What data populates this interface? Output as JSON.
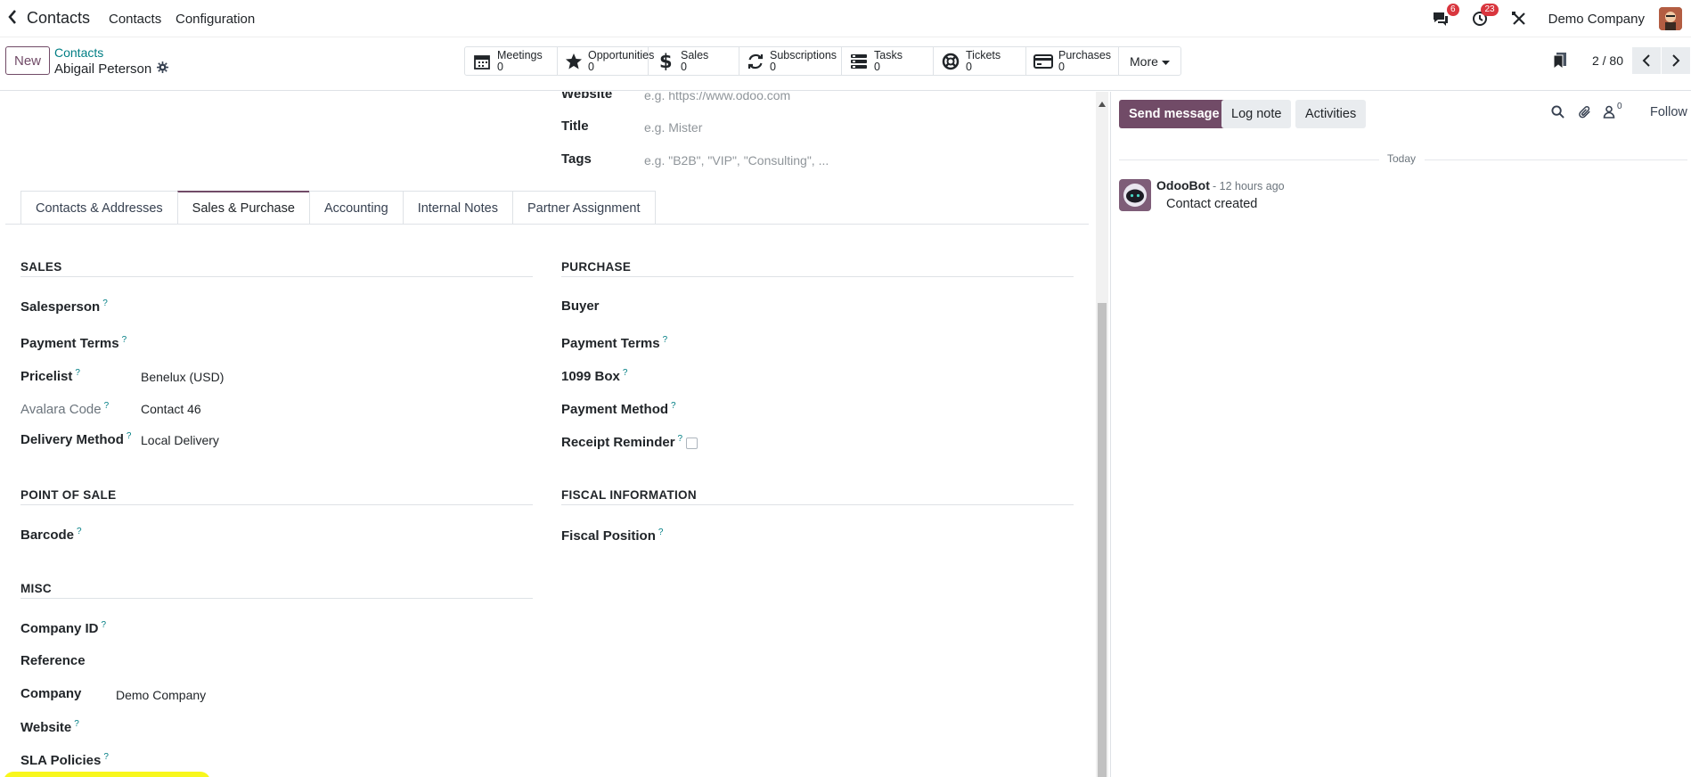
{
  "navbar": {
    "app_name": "Contacts",
    "menu": [
      "Contacts",
      "Configuration"
    ],
    "messages_badge": "6",
    "activities_badge": "23",
    "company": "Demo Company"
  },
  "control": {
    "new_label": "New",
    "breadcrumb_parent": "Contacts",
    "record_name": "Abigail Peterson",
    "smart_buttons": [
      {
        "label": "Meetings",
        "count": "0",
        "icon": "calendar-icon"
      },
      {
        "label": "Opportunities",
        "count": "0",
        "icon": "star-icon"
      },
      {
        "label": "Sales",
        "count": "0",
        "icon": "dollar-icon"
      },
      {
        "label": "Subscriptions",
        "count": "0",
        "icon": "refresh-icon"
      },
      {
        "label": "Tasks",
        "count": "0",
        "icon": "tasks-icon"
      },
      {
        "label": "Tickets",
        "count": "0",
        "icon": "lifebuoy-icon"
      },
      {
        "label": "Purchases",
        "count": "0",
        "icon": "credit-card-icon"
      }
    ],
    "more_label": "More",
    "pager": "2 / 80"
  },
  "form": {
    "top_fields": {
      "website_label": "Website",
      "website_placeholder": "e.g. https://www.odoo.com",
      "title_label": "Title",
      "title_placeholder": "e.g. Mister",
      "tags_label": "Tags",
      "tags_placeholder": "e.g. \"B2B\", \"VIP\", \"Consulting\", ..."
    },
    "tabs": [
      "Contacts & Addresses",
      "Sales & Purchase",
      "Accounting",
      "Internal Notes",
      "Partner Assignment"
    ],
    "active_tab": "Sales & Purchase",
    "sales": {
      "title": "SALES",
      "salesperson": "Salesperson",
      "payment_terms": "Payment Terms",
      "pricelist": "Pricelist",
      "pricelist_value": "Benelux (USD)",
      "avalara_code": "Avalara Code",
      "avalara_value": "Contact 46",
      "delivery_method": "Delivery Method",
      "delivery_value": "Local Delivery"
    },
    "purchase": {
      "title": "PURCHASE",
      "buyer": "Buyer",
      "payment_terms": "Payment Terms",
      "box_1099": "1099 Box",
      "payment_method": "Payment Method",
      "receipt_reminder": "Receipt Reminder"
    },
    "pos": {
      "title": "POINT OF SALE",
      "barcode": "Barcode"
    },
    "fiscal": {
      "title": "FISCAL INFORMATION",
      "fiscal_position": "Fiscal Position"
    },
    "misc": {
      "title": "MISC",
      "company_id": "Company ID",
      "reference": "Reference",
      "company": "Company",
      "company_value": "Demo Company",
      "website": "Website",
      "sla_policies": "SLA Policies"
    },
    "help_mark": "?"
  },
  "chatter": {
    "send_message": "Send message",
    "log_note": "Log note",
    "activities": "Activities",
    "followers_count": "0",
    "follow": "Follow",
    "today": "Today",
    "message": {
      "author": "OdooBot",
      "time": "- 12 hours ago",
      "body": "Contact created"
    }
  },
  "colors": {
    "brand": "#714b67",
    "link": "#017e84",
    "badge": "#d9363e",
    "highlight": "#f8f71c"
  }
}
